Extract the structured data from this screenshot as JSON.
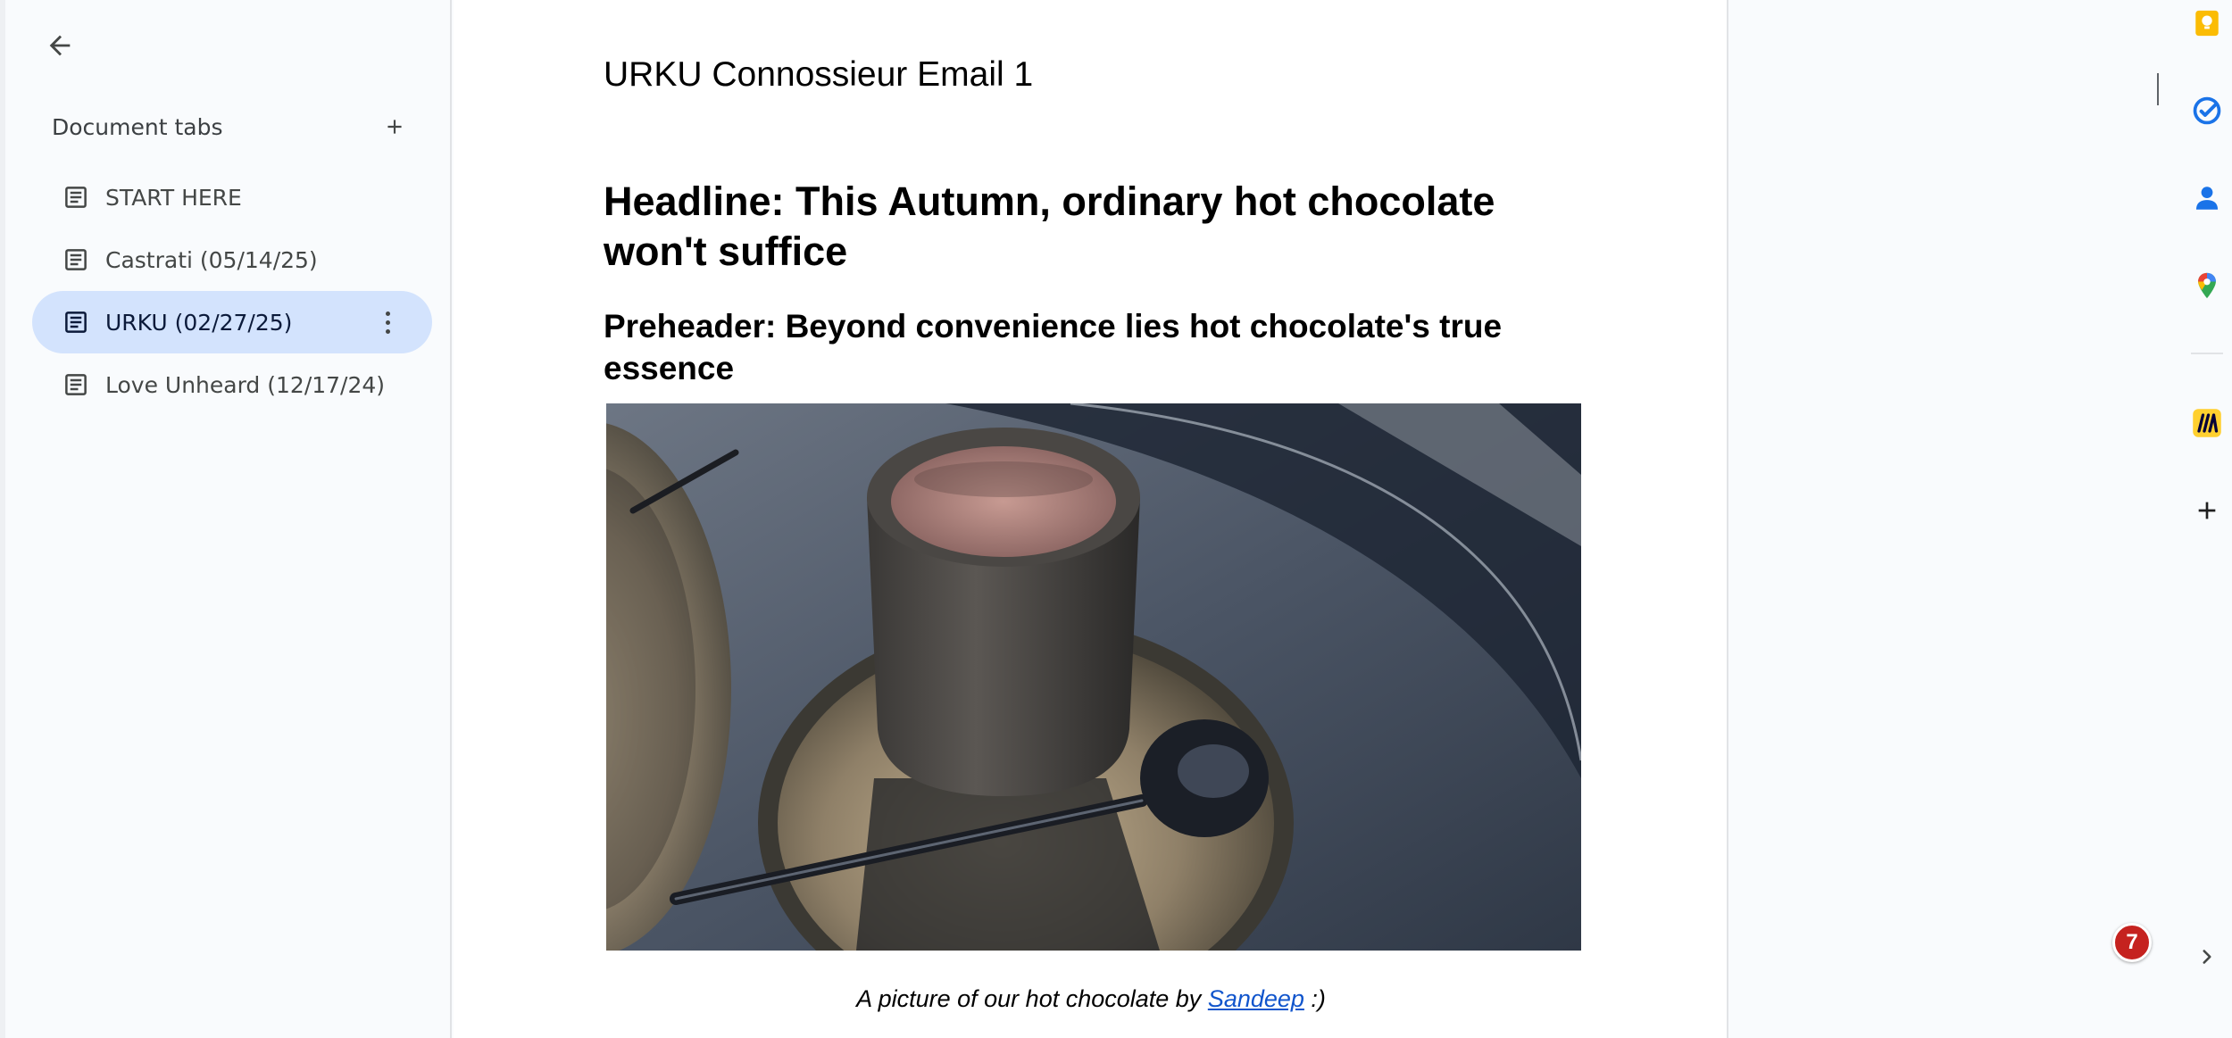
{
  "sidebar": {
    "title": "Document tabs",
    "tabs": [
      {
        "label": "START HERE",
        "active": false
      },
      {
        "label": "Castrati (05/14/25)",
        "active": false
      },
      {
        "label": "URKU (02/27/25)",
        "active": true
      },
      {
        "label": "Love Unheard (12/17/24)",
        "active": false
      }
    ]
  },
  "document": {
    "title": "URKU Connossieur Email 1",
    "headline": "Headline: This Autumn, ordinary hot chocolate won't suffice",
    "preheader": "Preheader: Beyond convenience lies hot chocolate's true essence",
    "caption": {
      "prefix": "A picture of our hot chocolate by ",
      "link": "Sandeep",
      "suffix": " :)"
    }
  },
  "side_panel": {
    "icons": [
      "keep-icon",
      "tasks-icon",
      "contacts-icon",
      "maps-icon",
      "miro-icon",
      "add-addon-icon"
    ]
  },
  "notification_badge": {
    "count": "7"
  },
  "colors": {
    "active_tab": "#d3e3fd",
    "link": "#1155cc",
    "keep": "#fbbc04",
    "tasks": "#1a73e8",
    "badge": "#c5221f"
  }
}
